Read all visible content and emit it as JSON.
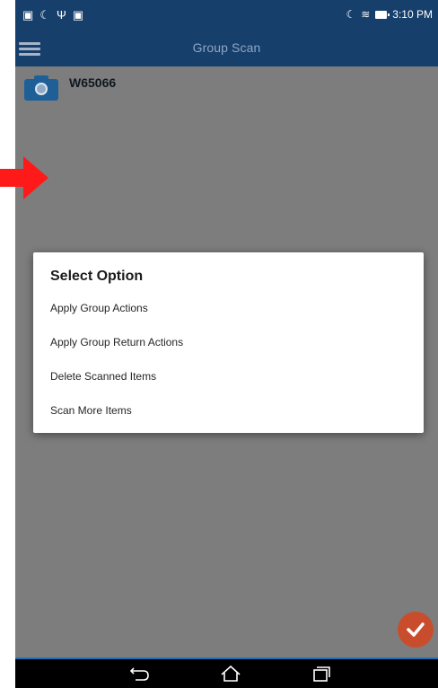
{
  "status_bar": {
    "time": "3:10 PM"
  },
  "app_bar": {
    "title": "Group Scan"
  },
  "scan_list": [
    {
      "code": "W65066"
    }
  ],
  "dialog": {
    "title": "Select Option",
    "options": [
      "Apply Group Actions",
      "Apply Group Return Actions",
      "Delete Scanned Items",
      "Scan More Items"
    ]
  },
  "colors": {
    "primary": "#173f6b",
    "accent": "#c94d2d",
    "overlay": "#7d7d7d",
    "annotation_arrow": "#ff1a1a"
  },
  "icons": [
    "image-icon",
    "moon-icon",
    "usb-icon",
    "bag-icon",
    "wifi-icon",
    "battery-icon",
    "menu-icon",
    "camera-icon",
    "check-icon",
    "back-icon",
    "home-icon",
    "recent-apps-icon"
  ]
}
